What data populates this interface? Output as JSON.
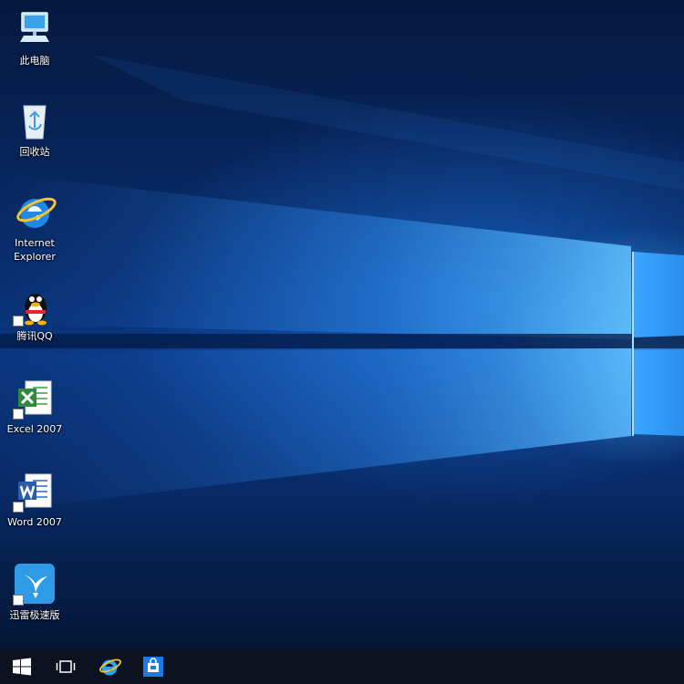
{
  "desktop": {
    "icons": [
      {
        "label": "此电脑",
        "icon": "computer-icon"
      },
      {
        "label": "回收站",
        "icon": "recycle-bin-icon"
      },
      {
        "label": "Internet\nExplorer",
        "icon": "internet-explorer-icon"
      },
      {
        "label": "腾讯QQ",
        "icon": "qq-icon"
      },
      {
        "label": "Excel 2007",
        "icon": "excel-icon"
      },
      {
        "label": "Word 2007",
        "icon": "word-icon"
      },
      {
        "label": "迅雷极速版",
        "icon": "xunlei-icon"
      }
    ]
  },
  "taskbar": {
    "buttons": [
      {
        "icon": "windows-start-icon"
      },
      {
        "icon": "task-view-icon"
      },
      {
        "icon": "internet-explorer-icon"
      },
      {
        "icon": "store-icon"
      }
    ]
  },
  "colors": {
    "taskbar": "#0d1220",
    "accent": "#1e78e6",
    "light_beam": "#5ab8ff"
  }
}
